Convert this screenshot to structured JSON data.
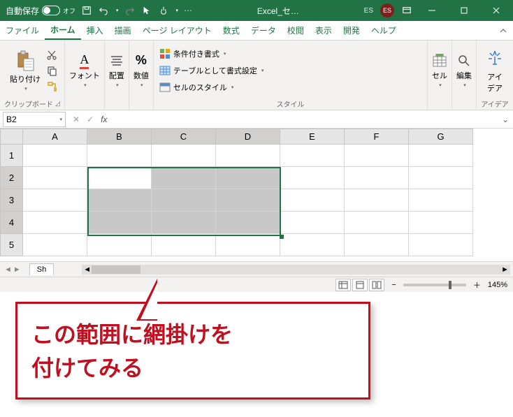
{
  "titlebar": {
    "autosave_label": "自動保存",
    "autosave_state": "オフ",
    "doc_title": "Excel_セ…",
    "user_initials_light": "ES",
    "user_initials_avatar": "ES"
  },
  "tabs": {
    "file": "ファイル",
    "home": "ホーム",
    "insert": "挿入",
    "draw": "描画",
    "page_layout": "ページ レイアウト",
    "formulas": "数式",
    "data": "データ",
    "review": "校閲",
    "view": "表示",
    "developer": "開発",
    "help": "ヘルプ"
  },
  "ribbon": {
    "clipboard": {
      "paste": "貼り付け",
      "group": "クリップボード"
    },
    "font": {
      "label": "フォント"
    },
    "alignment": {
      "label": "配置"
    },
    "number": {
      "label": "数値"
    },
    "styles": {
      "conditional": "条件付き書式",
      "format_table": "テーブルとして書式設定",
      "cell_styles": "セルのスタイル",
      "group": "スタイル"
    },
    "cells": {
      "label": "セル"
    },
    "editing": {
      "label": "編集"
    },
    "ideas": {
      "btn": "アイ\nデア",
      "group": "アイデア"
    }
  },
  "formula_bar": {
    "name_box": "B2",
    "formula": ""
  },
  "grid": {
    "columns": [
      "A",
      "B",
      "C",
      "D",
      "E",
      "F",
      "G"
    ],
    "rows": [
      "1",
      "2",
      "3",
      "4",
      "5"
    ],
    "selected_columns": [
      "B",
      "C",
      "D"
    ],
    "selected_rows": [
      "2",
      "3",
      "4"
    ],
    "active_cell": "B2",
    "cells": {}
  },
  "sheets": {
    "tab1": "Sh"
  },
  "status": {
    "zoom_minus": "−",
    "zoom_plus": "＋",
    "zoom_level": "145%"
  },
  "callout": {
    "line1": "この範囲に網掛けを",
    "line2": "付けてみる"
  }
}
